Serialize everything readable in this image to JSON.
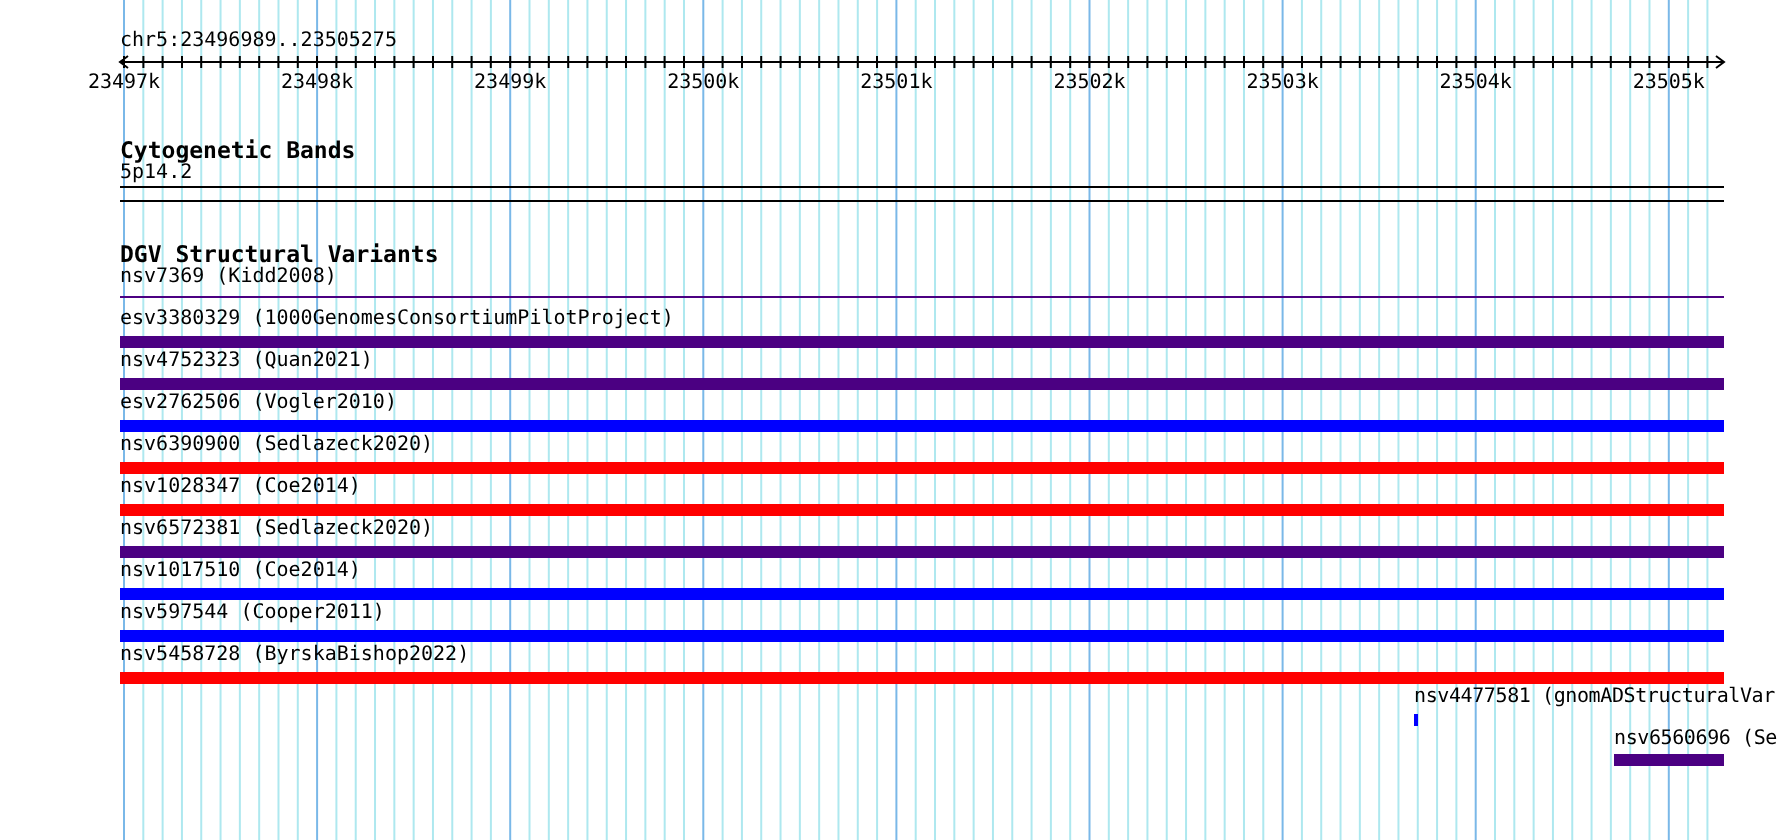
{
  "location": "chr5:23496989..23505275",
  "ruler": {
    "ticks": [
      "23497k",
      "23498k",
      "23499k",
      "23500k",
      "23501k",
      "23502k",
      "23503k",
      "23504k",
      "23505k"
    ]
  },
  "tracks": [
    {
      "title": "Cytogenetic Bands",
      "kind": "bands",
      "band_label": "5p14.2"
    },
    {
      "title": "DGV Structural Variants",
      "kind": "features",
      "features": [
        {
          "label": "nsv7369 (Kidd2008)",
          "kind": "line",
          "color": "#4b0082"
        },
        {
          "label": "esv3380329 (1000GenomesConsortiumPilotProject)",
          "kind": "bar",
          "color": "#4b0082"
        },
        {
          "label": "nsv4752323 (Quan2021)",
          "kind": "bar",
          "color": "#4b0082"
        },
        {
          "label": "esv2762506 (Vogler2010)",
          "kind": "bar",
          "color": "#0000ff"
        },
        {
          "label": "nsv6390900 (Sedlazeck2020)",
          "kind": "bar",
          "color": "#ff0000"
        },
        {
          "label": "nsv1028347 (Coe2014)",
          "kind": "bar",
          "color": "#ff0000"
        },
        {
          "label": "nsv6572381 (Sedlazeck2020)",
          "kind": "bar",
          "color": "#4b0082"
        },
        {
          "label": "nsv1017510 (Coe2014)",
          "kind": "bar",
          "color": "#0000ff"
        },
        {
          "label": "nsv597544 (Cooper2011)",
          "kind": "bar",
          "color": "#0000ff"
        },
        {
          "label": "nsv5458728 (ByrskaBishop2022)",
          "kind": "bar",
          "color": "#ff0000"
        },
        {
          "label": "nsv4477581 (gnomADStructuralVar",
          "kind": "mark",
          "color": "#0000ff"
        },
        {
          "label": "nsv6560696 (Se",
          "kind": "partial",
          "color": "#4b0082"
        }
      ]
    }
  ]
}
